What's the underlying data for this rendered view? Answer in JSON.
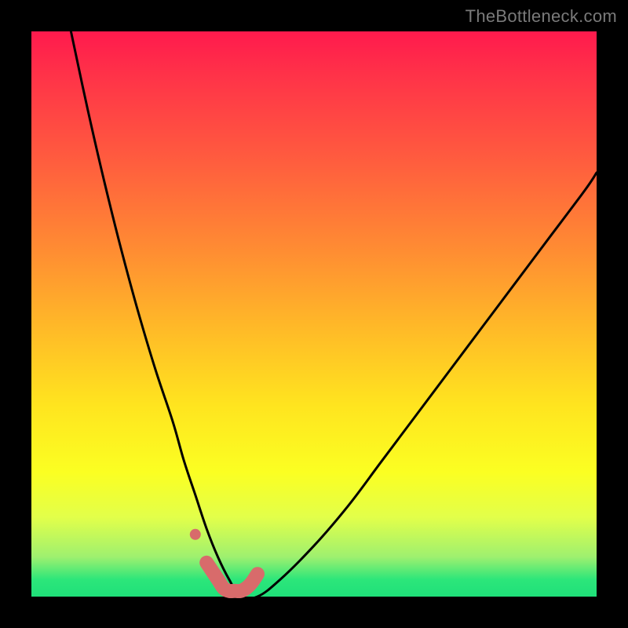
{
  "watermark": "TheBottleneck.com",
  "chart_data": {
    "type": "line",
    "title": "",
    "xlabel": "",
    "ylabel": "",
    "xlim": [
      0,
      100
    ],
    "ylim": [
      0,
      100
    ],
    "series": [
      {
        "name": "bottleneck-curve",
        "note": "V-shaped black performance/bottleneck curve; y read as % from top (0%) to bottom (100%)",
        "x": [
          7,
          10,
          13,
          16,
          19,
          22,
          25,
          27,
          29,
          31,
          33,
          35,
          37,
          40,
          44,
          50,
          56,
          62,
          68,
          74,
          80,
          86,
          92,
          98,
          100
        ],
        "y": [
          0,
          14,
          27,
          39,
          50,
          60,
          69,
          76,
          82,
          88,
          93,
          97,
          100,
          100,
          97,
          91,
          84,
          76,
          68,
          60,
          52,
          44,
          36,
          28,
          25
        ]
      },
      {
        "name": "highlight-dots",
        "note": "salmon/coral marker strip near the curve minimum",
        "x": [
          29,
          31,
          33,
          34,
          35,
          36,
          37,
          38,
          39,
          40
        ],
        "y": [
          89,
          94,
          97,
          98.5,
          99,
          99,
          99,
          98.5,
          97.5,
          96
        ]
      }
    ],
    "background_gradient": {
      "top": "#ff1a4d",
      "upper_mid": "#ff8a33",
      "mid": "#ffe41f",
      "lower_mid": "#e2ff4a",
      "bottom": "#1fe079"
    },
    "marker_color": "#d86b6b",
    "curve_color": "#000000"
  }
}
